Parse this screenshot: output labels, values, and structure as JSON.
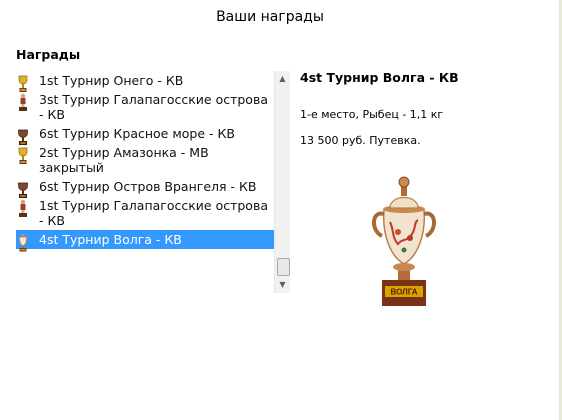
{
  "header": {
    "title": "Ваши награды"
  },
  "awards_section": {
    "label": "Награды"
  },
  "awards": [
    {
      "label": "1st Турнир Онего - КВ",
      "icon": "trophy-gold-icon",
      "selected": false
    },
    {
      "label": "3st Турнир Галапагосские острова - КВ",
      "icon": "trophy-figurine-icon",
      "selected": false
    },
    {
      "label": "6st Турнир Красное море - КВ",
      "icon": "trophy-dark-icon",
      "selected": false
    },
    {
      "label": "2st Турнир Амазонка - МВ закрытый",
      "icon": "trophy-gold-icon",
      "selected": false
    },
    {
      "label": "6st Турнир Остров Врангеля - КВ",
      "icon": "trophy-dark-icon",
      "selected": false
    },
    {
      "label": "1st Турнир Галапагосские острова - КВ",
      "icon": "trophy-figurine-icon",
      "selected": false
    },
    {
      "label": "4st Турнир Волга - КВ",
      "icon": "trophy-cup-icon",
      "selected": true
    }
  ],
  "detail": {
    "title": "4st Турнир Волга - КВ",
    "place": "1-е место, Рыбец - 1,1 кг",
    "prize": "13 500 руб. Путевка.",
    "trophy_plaque": "ВОЛГА"
  },
  "colors": {
    "selection": "#3399ff",
    "trophy_base": "#8a3a1a",
    "trophy_plaque": "#d9a200"
  }
}
